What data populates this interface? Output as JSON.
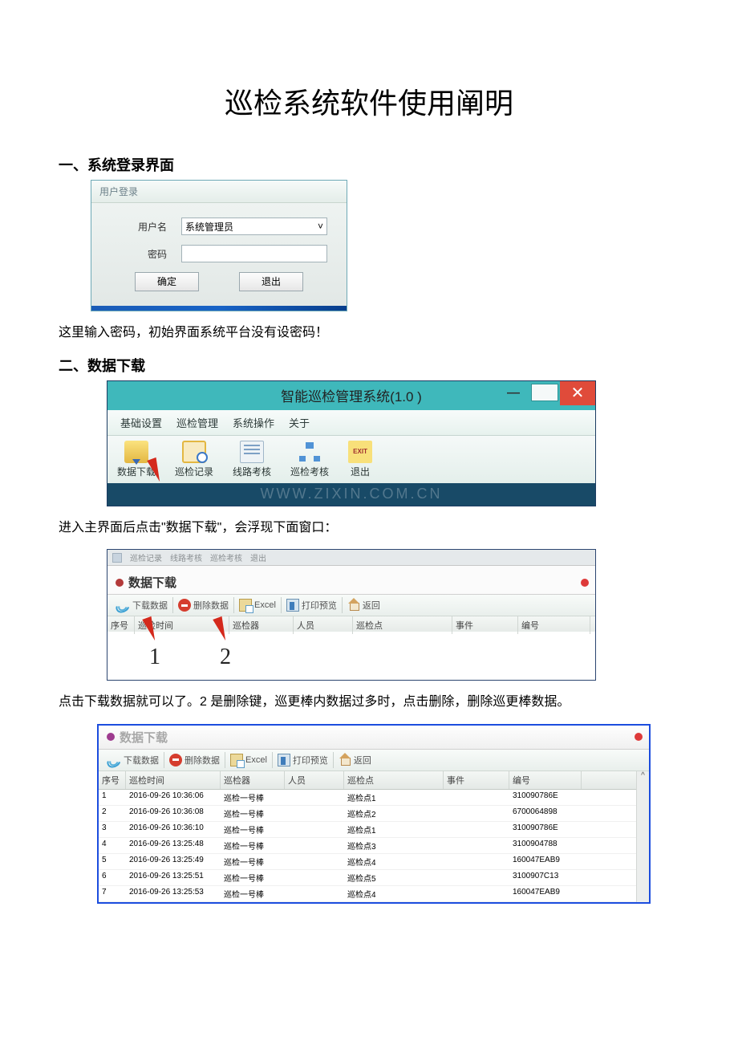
{
  "document": {
    "title": "巡检系统软件使用阐明",
    "section1_heading": "一、系统登录界面",
    "section1_text": "这里输入密码，初始界面系统平台没有设密码！",
    "section2_heading": "二、数据下载",
    "section2_text1": "进入主界面后点击\"数据下载\"，会浮现下面窗口：",
    "section2_text2": "点击下载数据就可以了。2 是删除键，巡更棒内数据过多时，点击删除，删除巡更棒数据。"
  },
  "login": {
    "dialog_title": "用户登录",
    "username_label": "用户名",
    "username_value": "系统管理员",
    "password_label": "密码",
    "ok": "确定",
    "exit": "退出"
  },
  "mainwin": {
    "title": "智能巡检管理系统(1.0 )",
    "menu": {
      "m1": "基础设置",
      "m2": "巡检管理",
      "m3": "系统操作",
      "m4": "关于"
    },
    "tb": {
      "download": "数据下载",
      "record": "巡检记录",
      "route": "线路考核",
      "check": "巡检考核",
      "exit": "退出",
      "exit_icon": "EXIT"
    },
    "watermark": "WWW.ZIXIN.COM.CN"
  },
  "dlwin": {
    "disabled_menu": {
      "a": "巡检记录",
      "b": "线路考核",
      "c": "巡检考核",
      "d": "退出"
    },
    "title": "数据下载",
    "tb": {
      "dl": "下载数据",
      "del": "删除数据",
      "xls": "Excel",
      "pp": "打印预览",
      "back": "返回"
    },
    "cols": {
      "seq": "序号",
      "time": "巡检时间",
      "dev": "巡检器",
      "person": "人员",
      "point": "巡检点",
      "event": "事件",
      "code": "编号"
    },
    "marker1": "1",
    "marker2": "2",
    "caret": "^"
  },
  "dlrows": [
    {
      "seq": "1",
      "time": "2016-09-26 10:36:06",
      "dev": "巡检一号棒",
      "person": "",
      "point": "巡检点1",
      "event": "",
      "code": "310090786E"
    },
    {
      "seq": "2",
      "time": "2016-09-26 10:36:08",
      "dev": "巡检一号棒",
      "person": "",
      "point": "巡检点2",
      "event": "",
      "code": "6700064898"
    },
    {
      "seq": "3",
      "time": "2016-09-26 10:36:10",
      "dev": "巡检一号棒",
      "person": "",
      "point": "巡检点1",
      "event": "",
      "code": "310090786E"
    },
    {
      "seq": "4",
      "time": "2016-09-26 13:25:48",
      "dev": "巡检一号棒",
      "person": "",
      "point": "巡检点3",
      "event": "",
      "code": "3100904788"
    },
    {
      "seq": "5",
      "time": "2016-09-26 13:25:49",
      "dev": "巡检一号棒",
      "person": "",
      "point": "巡检点4",
      "event": "",
      "code": "160047EAB9"
    },
    {
      "seq": "6",
      "time": "2016-09-26 13:25:51",
      "dev": "巡检一号棒",
      "person": "",
      "point": "巡检点5",
      "event": "",
      "code": "3100907C13"
    },
    {
      "seq": "7",
      "time": "2016-09-26 13:25:53",
      "dev": "巡检一号棒",
      "person": "",
      "point": "巡检点4",
      "event": "",
      "code": "160047EAB9"
    }
  ]
}
